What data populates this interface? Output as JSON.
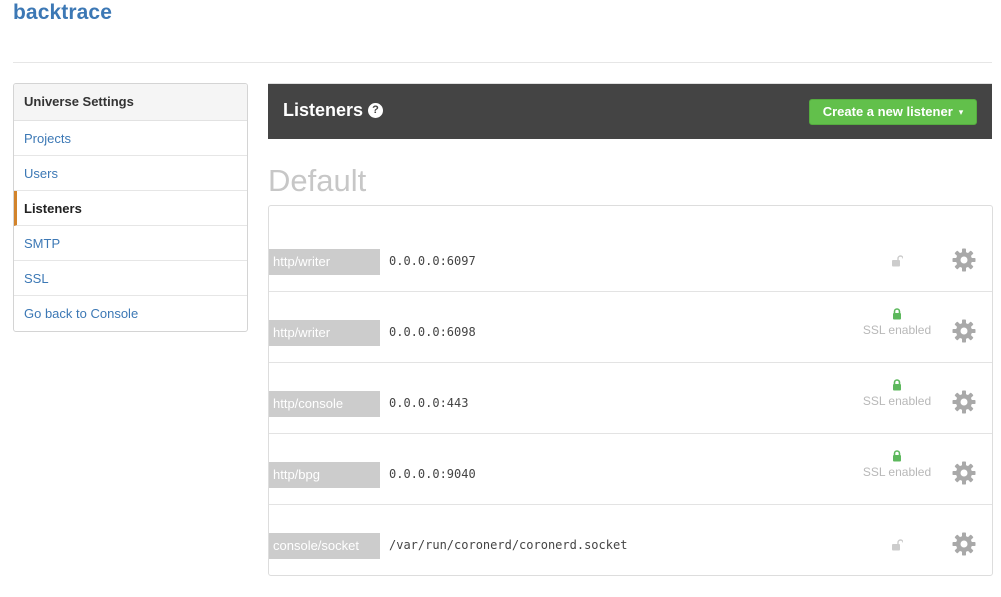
{
  "brand": "backtrace",
  "sidebar": {
    "heading": "Universe Settings",
    "items": [
      {
        "label": "Projects"
      },
      {
        "label": "Users"
      },
      {
        "label": "Listeners"
      },
      {
        "label": "SMTP"
      },
      {
        "label": "SSL"
      },
      {
        "label": "Go back to Console"
      }
    ],
    "active": "Listeners"
  },
  "header": {
    "title": "Listeners",
    "help_icon": "question-circle-icon",
    "create_button": "Create a new listener"
  },
  "section_title": "Default",
  "listeners": [
    {
      "type": "http/writer",
      "address": "0.0.0.0:6097",
      "ssl": false,
      "ssl_label": ""
    },
    {
      "type": "http/writer",
      "address": "0.0.0.0:6098",
      "ssl": true,
      "ssl_label": "SSL enabled"
    },
    {
      "type": "http/console",
      "address": "0.0.0.0:443",
      "ssl": true,
      "ssl_label": "SSL enabled"
    },
    {
      "type": "http/bpg",
      "address": "0.0.0.0:9040",
      "ssl": true,
      "ssl_label": "SSL enabled"
    },
    {
      "type": "console/socket",
      "address": "/var/run/coronerd/coronerd.socket",
      "ssl": false,
      "ssl_label": ""
    }
  ],
  "colors": {
    "brand": "#3c78b5",
    "header_bg": "#444444",
    "button_green": "#62c04b",
    "ssl_lock_green": "#5cb85c",
    "ssl_lock_gray": "#cccccc",
    "active_accent": "#d2832b"
  }
}
